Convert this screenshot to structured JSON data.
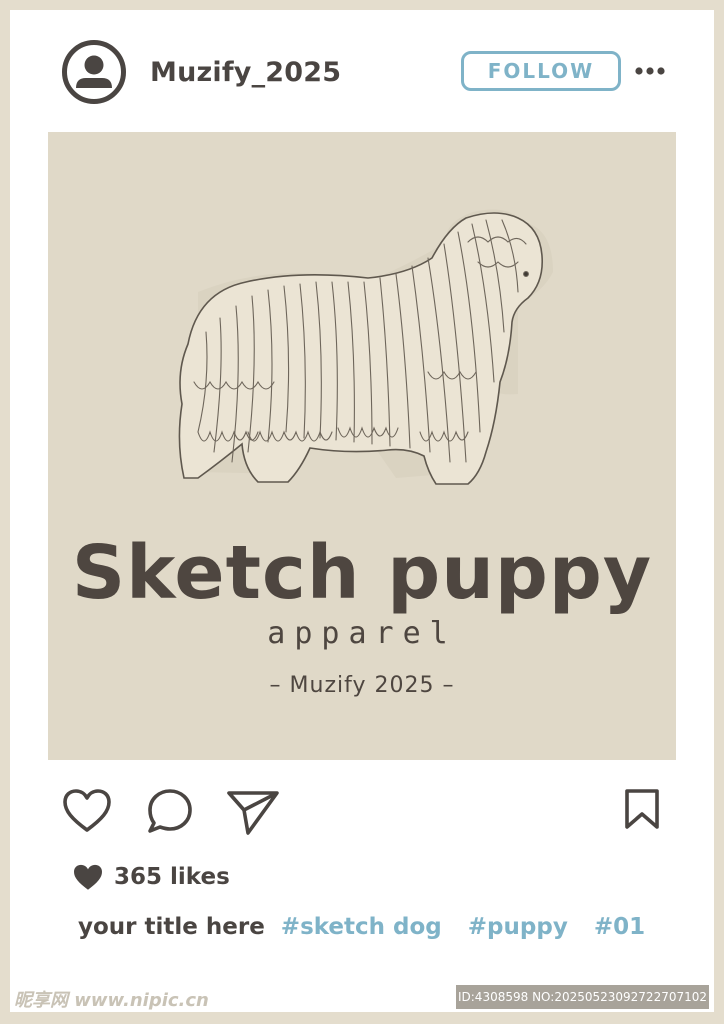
{
  "post": {
    "username": "Muzify_2025",
    "follow_label": "FOLLOW",
    "image": {
      "title": "Sketch puppy",
      "subtitle": "apparel",
      "credit": "– Muzify 2025 –"
    },
    "likes_label": "365 likes",
    "caption": {
      "title": "your title here",
      "hashtags": [
        "#sketch dog",
        "#puppy",
        "#01"
      ]
    }
  },
  "icons": {
    "avatar": "user-avatar-icon",
    "more": "more-horizontal-icon",
    "like": "heart-outline-icon",
    "comment": "speech-bubble-icon",
    "share": "paper-plane-icon",
    "save": "bookmark-icon",
    "likes": "heart-filled-icon"
  },
  "colors": {
    "frame": "#e4ddcd",
    "image_bg": "#e0d9c8",
    "accent": "#7fb3c8",
    "text_dark": "#4a4542"
  },
  "watermark": {
    "left": "昵享网 www.nipic.cn",
    "right": "ID:4308598 NO:20250523092722707102"
  }
}
